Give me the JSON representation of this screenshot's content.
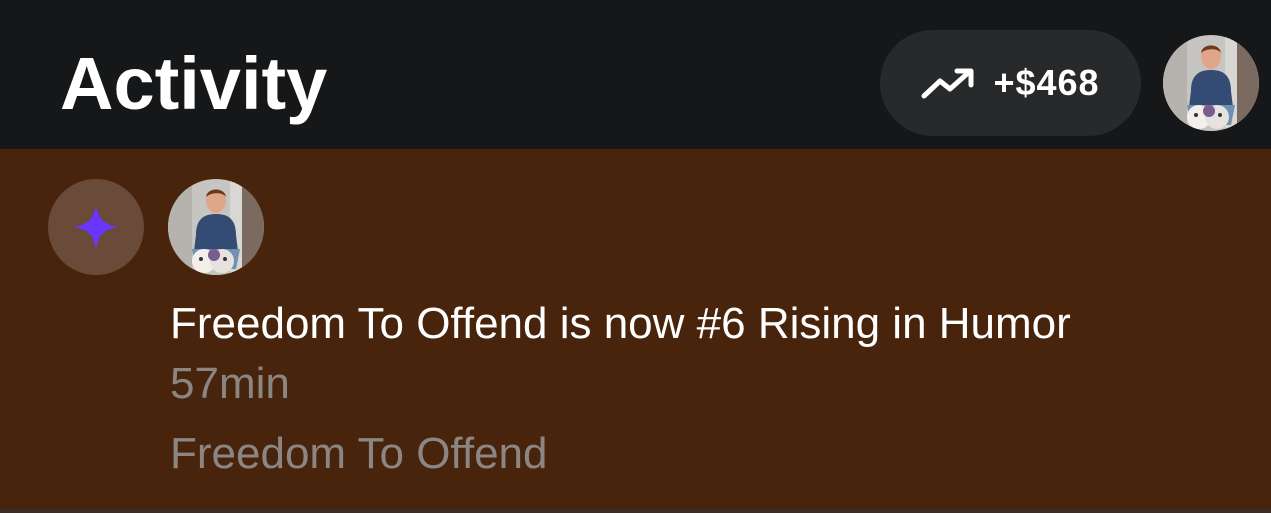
{
  "header": {
    "title": "Activity",
    "earnings": {
      "icon": "trending-up-icon",
      "value": "+$468"
    },
    "profile_avatar": "avatar-icon"
  },
  "activity": {
    "items": [
      {
        "badge_icon": "sparkle-icon",
        "avatar": "avatar-icon",
        "message": "Freedom To Offend is now #6 Rising in Humor",
        "time": "57min",
        "subtitle": "Freedom To Offend"
      }
    ]
  },
  "colors": {
    "header_bg": "#161718",
    "panel_bg": "#49240d",
    "pill_bg": "#27292a",
    "badge_bg": "#6a4a38",
    "accent_purple": "#6a35ff",
    "secondary_text": "#8c8682"
  }
}
